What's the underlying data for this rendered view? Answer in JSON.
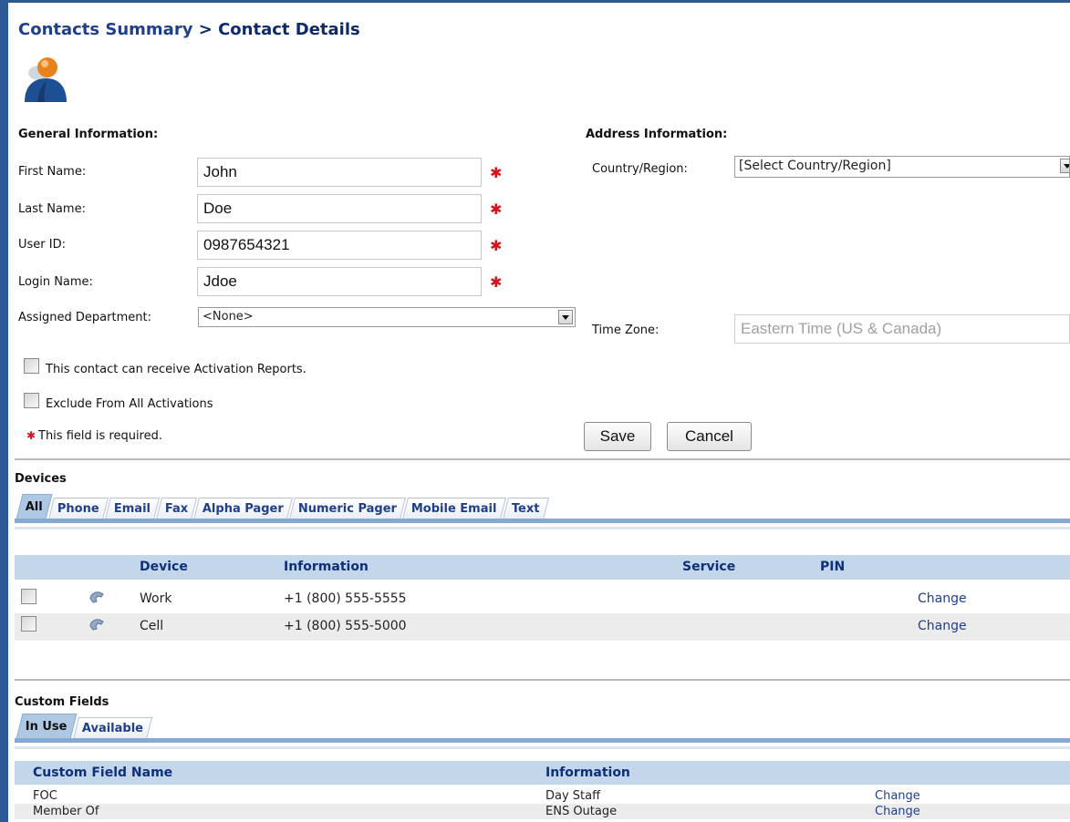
{
  "breadcrumb": {
    "parent": "Contacts Summary",
    "separator": " > ",
    "current": "Contact Details"
  },
  "general": {
    "title": "General Information:",
    "first_name_label": "First Name:",
    "first_name": "John",
    "last_name_label": "Last Name:",
    "last_name": "Doe",
    "user_id_label": "User ID:",
    "user_id": "0987654321",
    "login_name_label": "Login Name:",
    "login_name": "Jdoe",
    "department_label": "Assigned Department:",
    "department": "<None>",
    "activation_reports_label": "This contact can receive Activation Reports.",
    "exclude_label": "Exclude From All Activations",
    "required_note": "This field is required.",
    "required_mark": "✱"
  },
  "address": {
    "title": "Address Information:",
    "country_label": "Country/Region:",
    "country": "[Select Country/Region]",
    "timezone_label": "Time Zone:",
    "timezone": "Eastern Time (US & Canada)"
  },
  "actions": {
    "save": "Save",
    "cancel": "Cancel"
  },
  "devices": {
    "title": "Devices",
    "tabs": [
      "All",
      "Phone",
      "Email",
      "Fax",
      "Alpha Pager",
      "Numeric Pager",
      "Mobile Email",
      "Text"
    ],
    "active_tab": "All",
    "columns": {
      "device": "Device",
      "information": "Information",
      "service": "Service",
      "pin": "PIN"
    },
    "rows": [
      {
        "device": "Work",
        "information": "+1 (800) 555-5555",
        "action": "Change"
      },
      {
        "device": "Cell",
        "information": "+1 (800) 555-5000",
        "action": "Change"
      }
    ]
  },
  "custom_fields": {
    "title": "Custom Fields",
    "tabs": [
      "In Use",
      "Available"
    ],
    "active_tab": "In Use",
    "columns": {
      "name": "Custom Field Name",
      "information": "Information"
    },
    "rows": [
      {
        "name": "FOC",
        "information": "Day Staff",
        "action": "Change"
      },
      {
        "name": "Member Of",
        "information": "ENS Outage",
        "action": "Change"
      }
    ]
  },
  "colors": {
    "frame": "#2d5a94",
    "header_bg": "#c4d6ea",
    "link": "#1f3f8a",
    "required": "#d4141b"
  }
}
